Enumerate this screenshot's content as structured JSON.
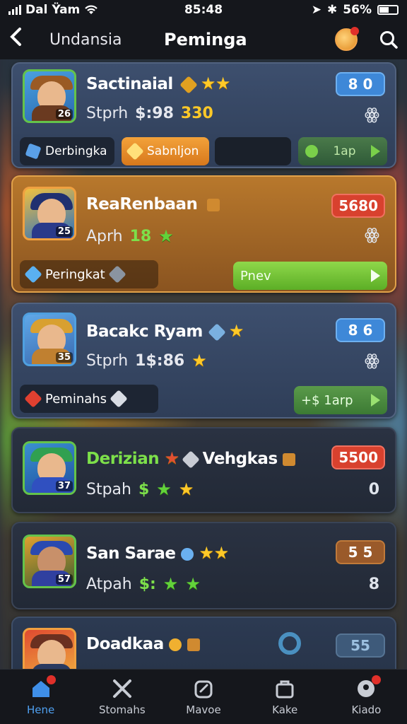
{
  "status": {
    "carrier": "Dal Ÿam",
    "time": "85:48",
    "battery": "56%"
  },
  "header": {
    "subtitle": "Undansia",
    "title": "Peminga"
  },
  "cards": [
    {
      "name": "Sactinaial",
      "stat_label": "Stprh",
      "stat_value": "$:98",
      "stat_value2": "330",
      "level": "26",
      "badge": "8 0",
      "side": "ꙮ",
      "action1": "Derbingka",
      "action2": "Sabnljon",
      "action3": "1ap"
    },
    {
      "name": "ReaRenbaan",
      "stat_label": "Aprh",
      "stat_value": "18",
      "level": "25",
      "badge": "5680",
      "side": "ꙮ",
      "action1": "Peringkat",
      "action2": "Pnev"
    },
    {
      "name": "Bacakc Ryam",
      "stat_label": "Stprh",
      "stat_value": "1$:86",
      "level": "35",
      "badge": "8 6",
      "side": "ꙮ",
      "action1": "Peminahs",
      "action2": "+$ 1arp"
    },
    {
      "name": "Derizian",
      "name2": "Vehgkas",
      "stat_label": "Stpah",
      "stat_value": "$",
      "level": "37",
      "badge": "5500",
      "side": "0"
    },
    {
      "name": "San Sarae",
      "stat_label": "Atpah",
      "stat_value": "$:",
      "level": "57",
      "badge": "5 5",
      "side": "8"
    },
    {
      "name": "Doadkaa",
      "badge": "55"
    }
  ],
  "nav": [
    {
      "label": "Hene",
      "active": true,
      "dot": true
    },
    {
      "label": "Stomahs",
      "active": false,
      "dot": false
    },
    {
      "label": "Mavoe",
      "active": false,
      "dot": false
    },
    {
      "label": "Kake",
      "active": false,
      "dot": false
    },
    {
      "label": "Kiado",
      "active": false,
      "dot": true
    }
  ],
  "colors": {
    "accent": "#4fa0f0",
    "gold": "#ffc928",
    "green": "#7de04a",
    "red": "#d8412e"
  }
}
